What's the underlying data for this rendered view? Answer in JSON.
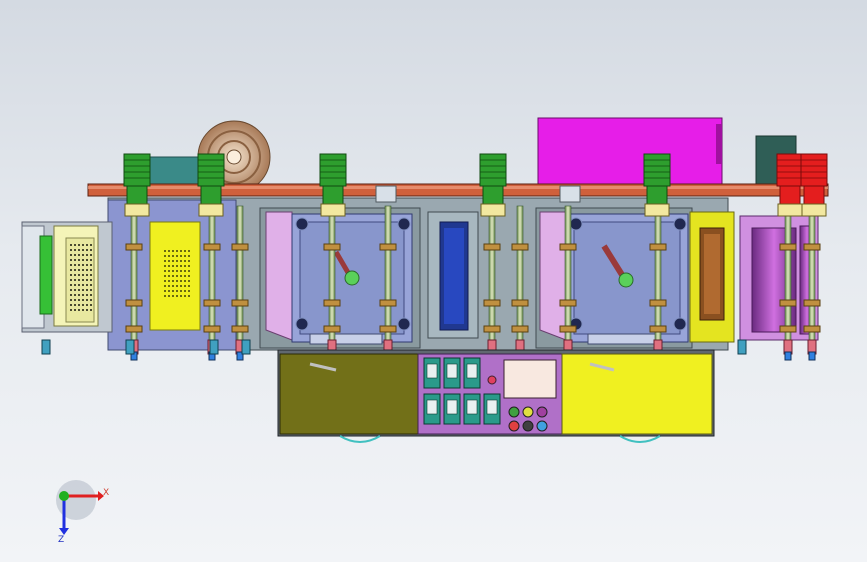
{
  "colors": {
    "background_top": "#d4dae2",
    "background_bottom": "#f2f4f7",
    "rail": "#d0603c",
    "motor_green": "#2e9e2e",
    "motor_red": "#e41e1e",
    "housing_magenta": "#e61ee8",
    "panel_yellow": "#f0f020",
    "base_olive": "#707018",
    "control_purple": "#b070c8",
    "plate_blue": "#8894c8",
    "frame_gray": "#8a9aa0",
    "roller_purple": "#b030c0",
    "axis_x": "#e02020",
    "axis_y": "#20b020",
    "axis_z": "#2030e0"
  },
  "triad": {
    "x_label": "X",
    "z_label": "Z"
  }
}
